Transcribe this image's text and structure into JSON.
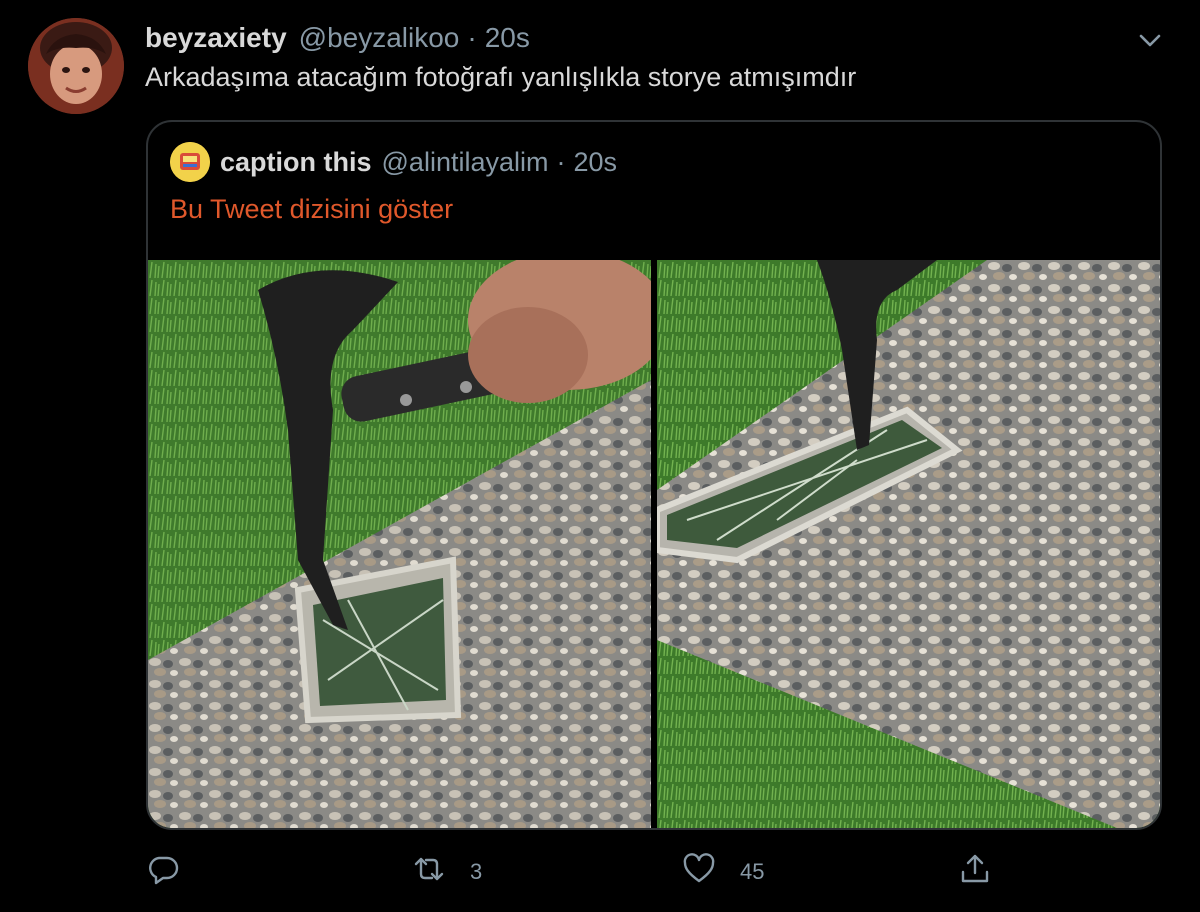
{
  "tweet": {
    "display_name": "beyzaxiety",
    "handle": "@beyzalikoo",
    "separator": "·",
    "time": "20s",
    "text": "Arkadaşıma atacağım fotoğrafı yanlışlıkla storye atmışımdır"
  },
  "quote": {
    "display_name": "caption this",
    "handle": "@alintilayalim",
    "separator": "·",
    "time": "20s",
    "thread_link": "Bu Tweet dizisini göster"
  },
  "actions": {
    "reply_count": "",
    "retweet_count": "3",
    "like_count": "45"
  },
  "icons": {
    "more": "chevron-down-icon",
    "reply": "reply-icon",
    "retweet": "retweet-icon",
    "like": "heart-icon",
    "share": "share-icon"
  },
  "colors": {
    "background": "#000000",
    "text": "#d9d9d9",
    "secondary": "#8899a6",
    "link": "#e0582b",
    "border": "#2f3336"
  }
}
